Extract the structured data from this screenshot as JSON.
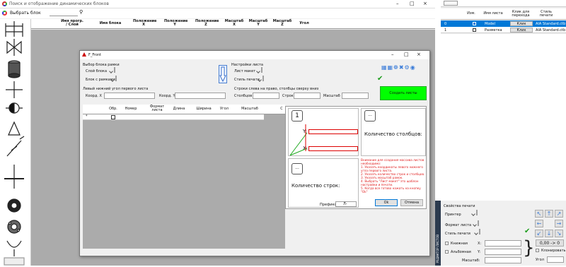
{
  "main": {
    "title": "Поиск и отображение динамических блоков",
    "select_block_label": "Выбрать блок",
    "columns": [
      "Имя прогр. / Слой",
      "Имя блока",
      "Положение X",
      "Положение Y",
      "Положение Z",
      "Масштаб X",
      "Масштаб Y",
      "Масштаб Z",
      "Угол"
    ]
  },
  "dialog": {
    "title": "F_Front",
    "frame_group": {
      "title": "Выбор блока рамки",
      "layer_label": "Слой блока",
      "block_label": "Блок с рамками"
    },
    "sheet_group": {
      "title": "Настройки листа",
      "layout_label": "Лист макет",
      "plotstyle_label": "Стиль печати"
    },
    "corner_group": {
      "title": "Левый нижний угол первого листа",
      "x_label": "Коорд. X",
      "y_label": "Коорд. Y"
    },
    "rows_group": {
      "title": "Строки слева на право, столбцы сверху вниз",
      "cols_label": "Столбцов",
      "rows_label": "Строк",
      "scale_label": "Масштаб"
    },
    "create_button": "Создать листы",
    "table_columns": [
      "Обр.",
      "Номер",
      "Формат листа",
      "Длина",
      "Ширина",
      "Угол",
      "Масштаб",
      "С"
    ],
    "new_row_marker": "*",
    "preview": {
      "step_num": "1",
      "x_label": "X:",
      "y_label": "Y:",
      "dots": "...",
      "cols_count": "Количество столбцов:",
      "rows_count": "Количество строк:",
      "prefix_label": "Префикс:",
      "prefix_value": "Л-"
    },
    "instructions": [
      "Внимание для создания массива листов необходимо:",
      "1. Указать координаты левого нижнего угла первого листа.",
      "2. Указать количество строк и столбцов.",
      "3. Указать масштаб рамок.",
      "4. Выбрать \"Лист макет\" это шаблон настройки и печати.",
      "5. Когда все готово нажать на кнопку \"Ok\""
    ],
    "ok_label": "Ok",
    "cancel_label": "Отмена"
  },
  "layouts": {
    "headers": [
      "Изм.",
      "Имя листа",
      "Клик для перехода",
      "Стиль печати"
    ],
    "rows": [
      {
        "num": "0",
        "name": "Model",
        "link": "Клик",
        "style": "AIA Standard.ctb",
        "selected": true
      },
      {
        "num": "1",
        "name": "Разметка",
        "link": "Клик",
        "style": "AIA Standard.ctb",
        "selected": false
      }
    ]
  },
  "print_props": {
    "title": "Свойства печати",
    "printer_label": "Принтер",
    "format_label": "Формат листа",
    "style_label": "Стиль печати",
    "x_label": "X:",
    "y_label": "Y:",
    "portrait": "Книжная",
    "landscape": "Альбомная",
    "scale_label": "Масштаб:",
    "origin_button": "0,00 -> 0",
    "clone_label": "Клонировать",
    "angle_label": "Угол",
    "side_tab": "РЕДАКТОР ЛИСТОВ"
  },
  "colors": {
    "selection": "#0078d7",
    "create": "#00ff00",
    "alert": "#e02020",
    "accent": "#3c7dd9"
  }
}
